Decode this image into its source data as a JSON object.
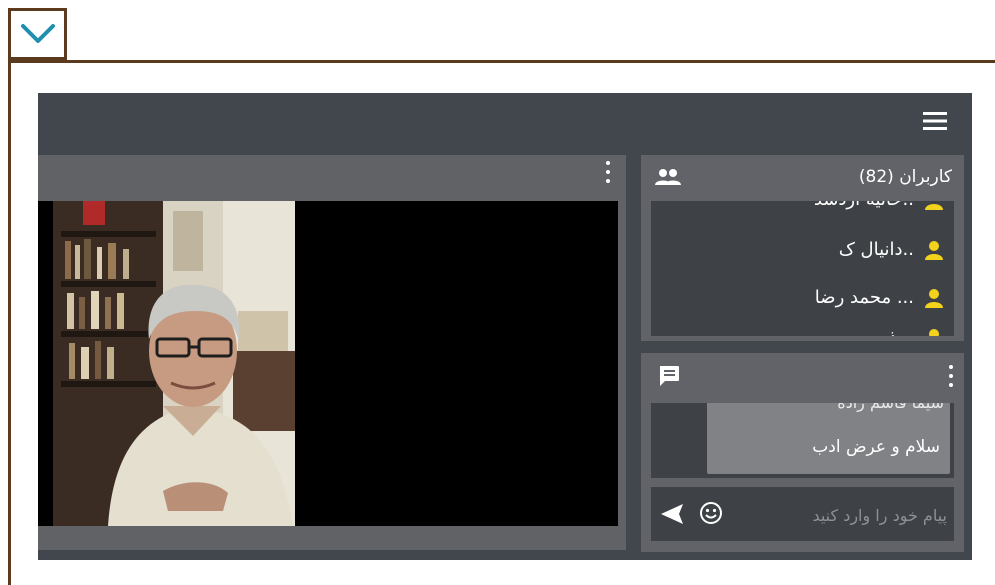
{
  "frame": {
    "accent_color": "#5b3a1e",
    "toggle_icon": "chevron-down-icon",
    "toggle_color": "#1f8fae"
  },
  "header": {
    "menu_icon": "hamburger-icon"
  },
  "video": {
    "menu_icon": "kebab-menu-icon"
  },
  "users": {
    "title": "کاربران (82)",
    "icon": "users-group-icon",
    "items": [
      {
        "name": "خانیه اژدشد..",
        "icon": "user-icon"
      },
      {
        "name": "دانیال ک..",
        "icon": "user-icon"
      },
      {
        "name": "محمد رضا ...",
        "icon": "user-icon"
      },
      {
        "name": "ذ...",
        "icon": "user-icon"
      }
    ],
    "icon_color": "#f2d21b"
  },
  "chat": {
    "icon": "chat-icon",
    "menu_icon": "kebab-menu-icon",
    "messages": [
      {
        "text": "شیما قاسم زاده"
      },
      {
        "text": "سلام و عرض ادب"
      }
    ],
    "input_placeholder": "پیام خود را وارد کنید",
    "emoji_icon": "smiley-icon",
    "send_icon": "send-icon"
  }
}
